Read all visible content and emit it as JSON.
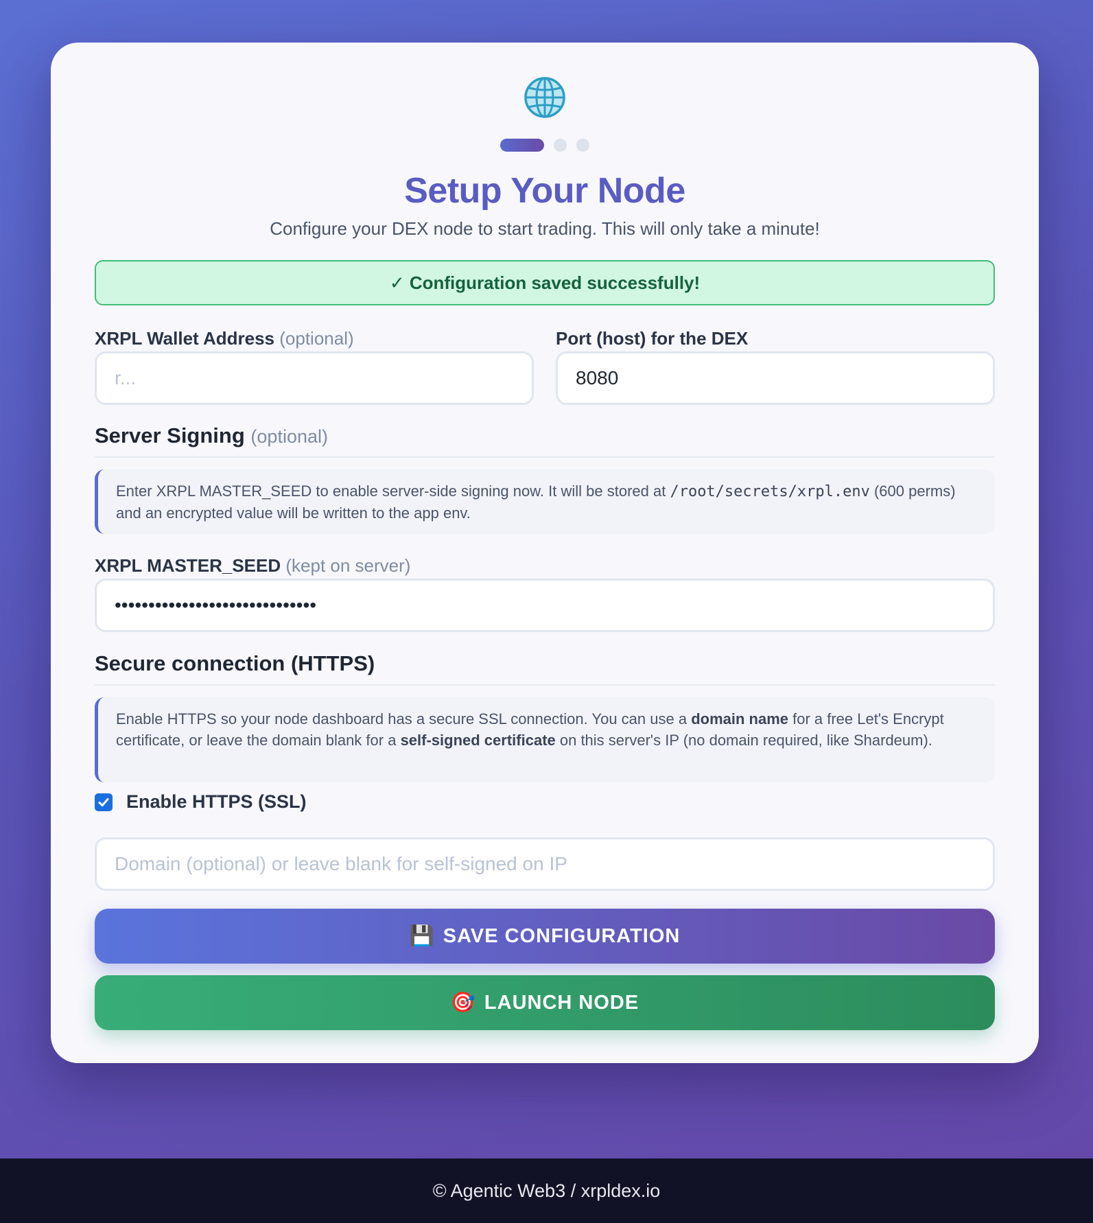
{
  "header": {
    "icon": "globe-icon",
    "steps_total": 3,
    "step_current": 1,
    "title": "Setup Your Node",
    "subtitle": "Configure your DEX node to start trading. This will only take a minute!"
  },
  "alert": {
    "text": "✓ Configuration saved successfully!",
    "colors": {
      "bg": "#d1f6e2",
      "border": "#3fbf79",
      "text": "#16623d"
    }
  },
  "wallet": {
    "label": "XRPL Wallet Address",
    "optional": "(optional)",
    "placeholder": "r...",
    "value": ""
  },
  "port": {
    "label": "Port (host) for the DEX",
    "value": "8080"
  },
  "server_signing": {
    "title": "Server Signing",
    "optional": "(optional)",
    "info_pre": "Enter XRPL MASTER_SEED to enable server-side signing now. It will be stored at ",
    "info_code": "/root/secrets/xrpl.env",
    "info_post": " (600 perms) and an encrypted value will be written to the app env."
  },
  "seed": {
    "label": "XRPL MASTER_SEED",
    "hint": "(kept on server)",
    "value": "sEdVxxxxxxxxxxxxxxxxxxxxxxxxxx"
  },
  "https": {
    "title": "Secure connection (HTTPS)",
    "info_1": "Enable HTTPS so your node dashboard has a secure SSL connection. You can use a ",
    "info_b1": "domain name",
    "info_2": " for a free Let's Encrypt certificate, or leave the domain blank for a ",
    "info_b2": "self-signed certificate",
    "info_3": " on this server's IP (no domain required, like Shardeum).",
    "checkbox_label": "Enable HTTPS (SSL)",
    "checked": true,
    "domain_placeholder": "Domain (optional) or leave blank for self-signed on IP",
    "domain_value": ""
  },
  "buttons": {
    "save_icon": "💾",
    "save_label": "SAVE CONFIGURATION",
    "launch_icon": "🎯",
    "launch_label": "LAUNCH NODE"
  },
  "footer": {
    "text": "© Agentic Web3 / xrpldex.io"
  },
  "colors": {
    "accent": "#5a5cc2",
    "success": "#38ad78",
    "checkbox": "#1a6fe0"
  }
}
